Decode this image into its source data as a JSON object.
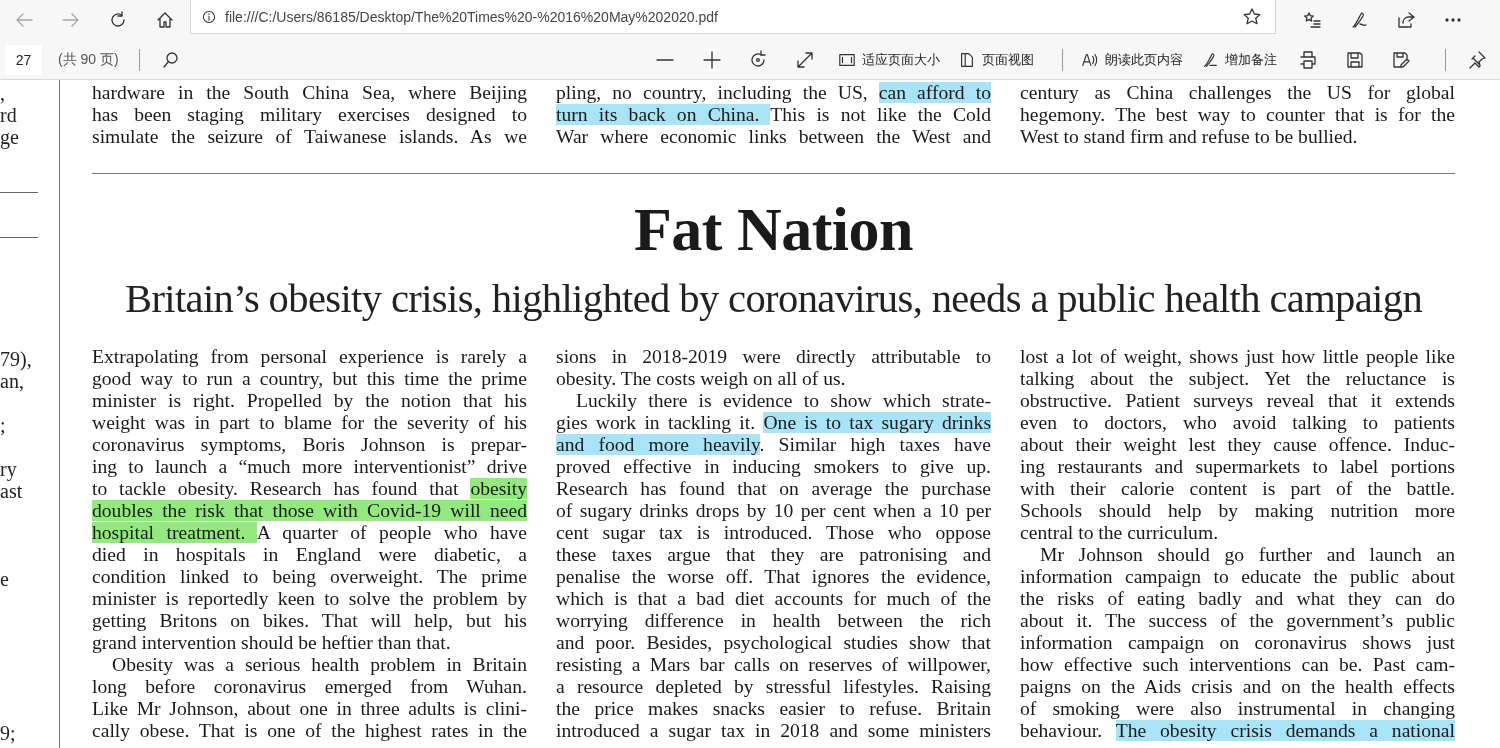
{
  "browser": {
    "url": "file:///C:/Users/86185/Desktop/The%20Times%20-%2016%20May%202020.pdf"
  },
  "pdf_toolbar": {
    "page_number": "27",
    "page_count": "(共 90 页)",
    "labeled_buttons": [
      {
        "kind": "fit",
        "label": "适应页面大小"
      },
      {
        "kind": "view",
        "label": "页面视图"
      },
      {
        "kind": "read",
        "label": "朗读此页内容"
      },
      {
        "kind": "note",
        "label": "增加备注"
      }
    ]
  },
  "previous_page": {
    "fragments": [
      {
        "kind": "text",
        "text": ","
      },
      {
        "kind": "text",
        "text": "rd"
      },
      {
        "kind": "text",
        "text": "ge"
      },
      {
        "kind": "blank"
      },
      {
        "kind": "blank"
      },
      {
        "kind": "rule"
      },
      {
        "kind": "blank"
      },
      {
        "kind": "rule"
      },
      {
        "kind": "blank"
      },
      {
        "kind": "blank"
      },
      {
        "kind": "blank"
      },
      {
        "kind": "blank"
      },
      {
        "kind": "text",
        "text": "79),"
      },
      {
        "kind": "text",
        "text": "an,"
      },
      {
        "kind": "blank"
      },
      {
        "kind": "text",
        "text": ";"
      },
      {
        "kind": "blank"
      },
      {
        "kind": "text",
        "text": "ry"
      },
      {
        "kind": "text",
        "text": "ast"
      },
      {
        "kind": "blank"
      },
      {
        "kind": "blank"
      },
      {
        "kind": "blank"
      },
      {
        "kind": "text",
        "text": "e"
      },
      {
        "kind": "blank"
      },
      {
        "kind": "blank"
      },
      {
        "kind": "blank"
      },
      {
        "kind": "blank"
      },
      {
        "kind": "blank"
      },
      {
        "kind": "blank"
      },
      {
        "kind": "text",
        "text": "9;"
      }
    ]
  },
  "page": {
    "previous_article": [
      [
        {
          "indent": false,
          "continues": true,
          "lines": [
            "hardware in the South China Sea, where Beijing",
            "has been staging military exercises designed to",
            "simulate the seizure of Taiwanese islands. As we"
          ]
        }
      ],
      [
        {
          "indent": false,
          "continues": true,
          "lines": [
            [
              {
                "text": "pling, no country, including the US, "
              },
              {
                "text": "can afford to",
                "color": "#a9e3f6"
              }
            ],
            [
              {
                "text": "turn its back on China. ",
                "color": "#a9e3f6"
              },
              {
                "text": "This is not like the Cold"
              }
            ],
            "War where economic links between the West and"
          ]
        }
      ],
      [
        {
          "indent": false,
          "continues": false,
          "lines": [
            "century as China challenges the US for global",
            "hegemony. The best way to counter that is for the",
            "West to stand firm and refuse to be bullied."
          ]
        }
      ]
    ],
    "headline": "Fat Nation",
    "subheadline": "Britain’s obesity crisis, highlighted by coronavirus, needs a public health campaign",
    "columns": [
      [
        {
          "indent": false,
          "continues": false,
          "lines": [
            "Extrapolating from personal experience is rarely a",
            "good way to run a country, but this time the prime",
            "minister is right. Propelled by the notion that his",
            "weight was in part to blame for the severity of his",
            "coronavirus symptoms, Boris Johnson is prepar-",
            "ing to launch a “much more interventionist” drive",
            [
              {
                "text": "to tackle obesity. Research has found that "
              },
              {
                "text": "obesity",
                "color": "#93e87f"
              }
            ],
            [
              {
                "text": "doubles the risk that those with Covid-19 will need",
                "color": "#93e87f"
              }
            ],
            [
              {
                "text": "hospital treatment. ",
                "color": "#93e87f"
              },
              {
                "text": "A quarter of people who have"
              }
            ],
            "died in hospitals in England were diabetic, a",
            "condition linked to being overweight. The prime",
            "minister is reportedly keen to solve the problem by",
            "getting Britons on bikes. That will help, but his",
            "grand intervention should be heftier than that."
          ]
        },
        {
          "indent": true,
          "continues": true,
          "lines": [
            "Obesity was a serious health problem in Britain",
            "long before coronavirus emerged from Wuhan.",
            "Like Mr Johnson, about one in three adults is clini-",
            "cally obese. That is one of the highest rates in the"
          ]
        }
      ],
      [
        {
          "indent": false,
          "continues": false,
          "lines": [
            "sions in 2018-2019 were directly attributable to",
            "obesity. The costs weigh on all of us."
          ]
        },
        {
          "indent": true,
          "continues": true,
          "lines": [
            "Luckily there is evidence to show which strate-",
            [
              {
                "text": "gies work in tackling it. "
              },
              {
                "text": "One is to tax sugary drinks",
                "color": "#a9e3f6"
              }
            ],
            [
              {
                "text": "and food more heavily",
                "color": "#a9e3f6"
              },
              {
                "text": ". Similar high taxes have"
              }
            ],
            "proved effective in inducing smokers to give up.",
            "Research has found that on average the purchase",
            "of sugary drinks drops by 10 per cent when a 10 per",
            "cent sugar tax is introduced. Those who oppose",
            "these taxes argue that they are patronising and",
            "penalise the worse off. That ignores the evidence,",
            "which is that a bad diet accounts for much of the",
            "worrying difference in health between the rich",
            "and poor. Besides, psychological studies show that",
            "resisting a Mars bar calls on reserves of willpower,",
            "a resource depleted by stressful lifestyles. Raising",
            "the price makes snacks easier to refuse. Britain",
            "introduced a sugar tax in 2018 and some ministers"
          ]
        }
      ],
      [
        {
          "indent": false,
          "continues": false,
          "lines": [
            "lost a lot of weight, shows just how little people like",
            "talking about the subject. Yet the reluctance is",
            "obstructive. Patient surveys reveal that it extends",
            "even to doctors, who avoid talking to patients",
            "about their weight lest they cause offence. Induc-",
            "ing restaurants and supermarkets to label portions",
            "with their calorie content is part of the battle.",
            "Schools should help by making nutrition more",
            "central to the curriculum."
          ]
        },
        {
          "indent": true,
          "continues": true,
          "lines": [
            "Mr Johnson should go further and launch an",
            "information campaign to educate the public about",
            "the risks of eating badly and what they can do",
            "about it. The success of the government’s public",
            "information campaign on coronavirus shows just",
            "how effective such interventions can be. Past cam-",
            "paigns on the Aids crisis and on the health effects",
            "of smoking were also instrumental in changing",
            [
              {
                "text": "behaviour. "
              },
              {
                "text": "The obesity crisis demands a national",
                "color": "#a9e3f6"
              }
            ]
          ]
        }
      ]
    ]
  }
}
